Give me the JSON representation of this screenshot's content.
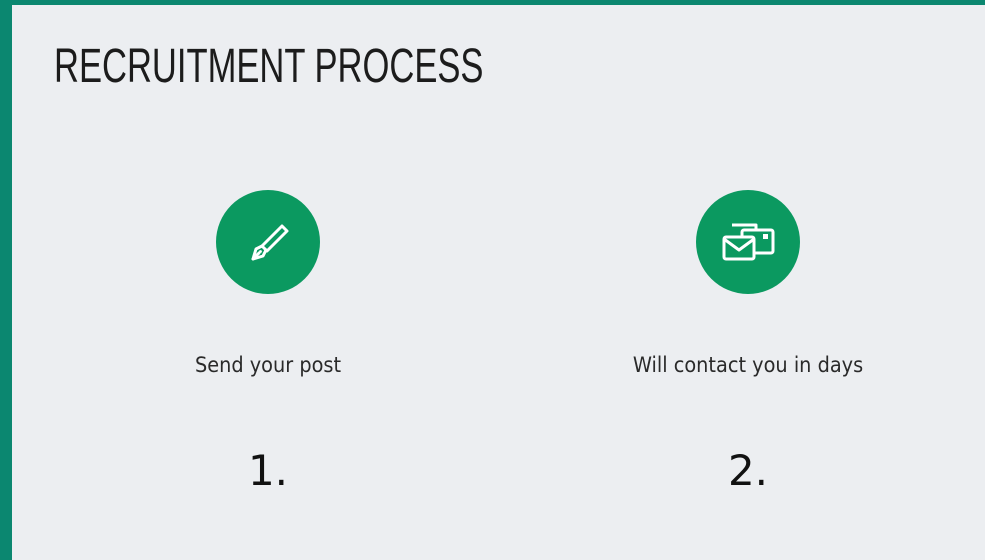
{
  "section": {
    "title": "RECRUITMENT PROCESS"
  },
  "steps": [
    {
      "icon": "pen-icon",
      "label": "Send your post",
      "number": "1."
    },
    {
      "icon": "mail-icon",
      "label": "Will contact you in days",
      "number": "2."
    }
  ],
  "colors": {
    "accent": "#0b9960",
    "frame": "#0b8770",
    "background": "#eceef1"
  }
}
